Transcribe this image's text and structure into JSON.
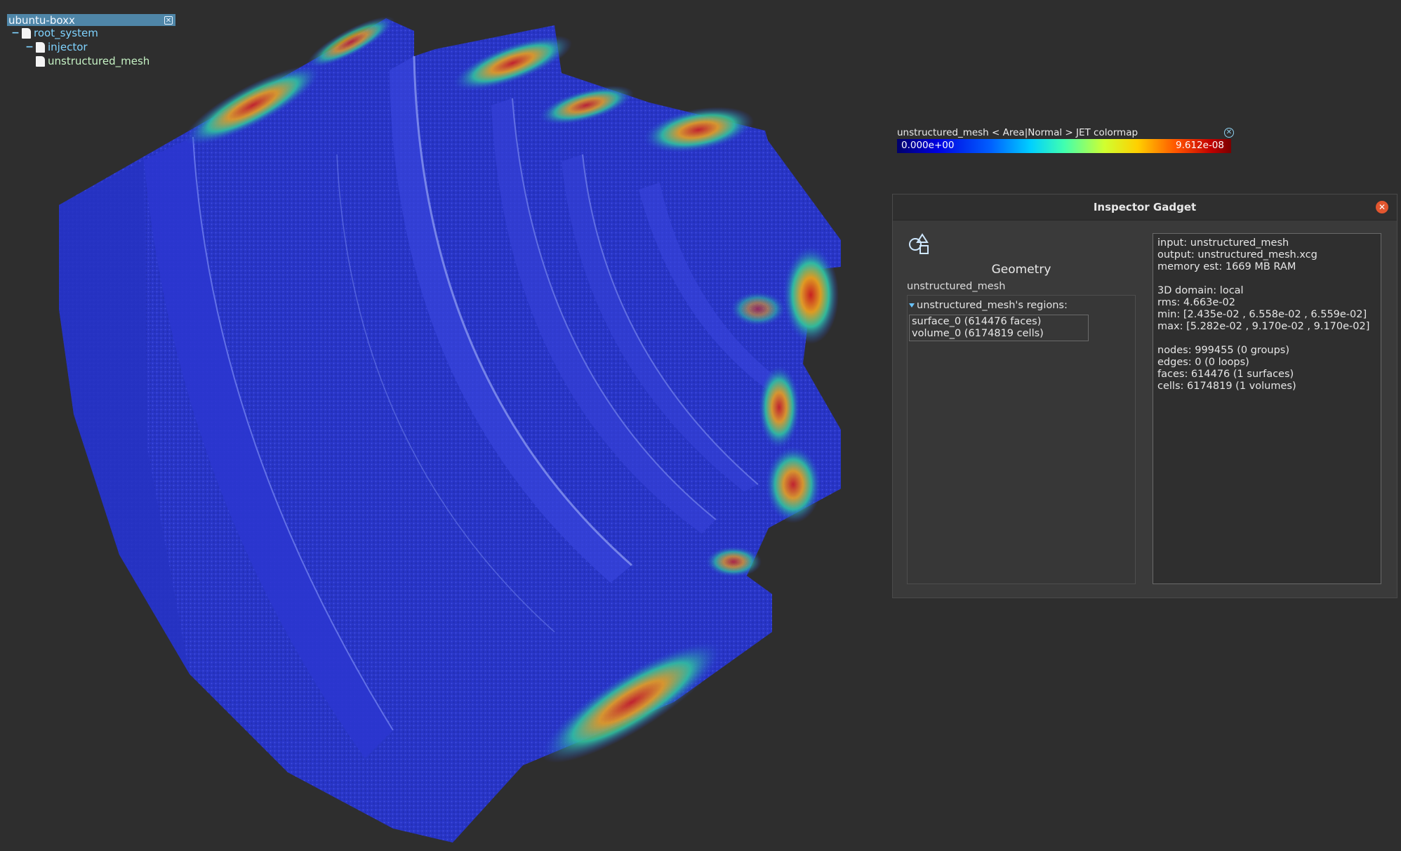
{
  "scene_tree": {
    "title": "ubuntu-boxx",
    "close_label": "✕",
    "items": [
      {
        "label": "root_system",
        "toggle": "−"
      },
      {
        "label": "injector",
        "toggle": "−"
      },
      {
        "label": "unstructured_mesh"
      }
    ]
  },
  "colorbar": {
    "title": "unstructured_mesh < Area|Normal > JET colormap",
    "min": "0.000e+00",
    "max": "9.612e-08",
    "close_label": "✕"
  },
  "inspector": {
    "title": "Inspector Gadget",
    "close_label": "✕",
    "geometry_heading": "Geometry",
    "object_name": "unstructured_mesh",
    "regions_heading": "unstructured_mesh's regions:",
    "regions": [
      "surface_0 (614476 faces)",
      "volume_0 (6174819 cells)"
    ],
    "info": {
      "input": "input: unstructured_mesh",
      "output": "output: unstructured_mesh.xcg",
      "memory": "memory est: 1669 MB RAM",
      "domain": "3D domain:  local",
      "rms": "rms: 4.663e-02",
      "min": "min: [2.435e-02 , 6.558e-02 , 6.559e-02]",
      "max": "max: [5.282e-02 , 9.170e-02 , 9.170e-02]",
      "nodes": "nodes: 999455 (0 groups)",
      "edges": "edges: 0 (0 loops)",
      "faces": "faces: 614476 (1 surfaces)",
      "cells": "cells: 6174819 (1 volumes)"
    }
  },
  "colors": {
    "background": "#2e2e2e",
    "mesh_blue": "#2a33c8",
    "tree_highlight": "#4f86a8",
    "close_orange": "#e2562f"
  }
}
